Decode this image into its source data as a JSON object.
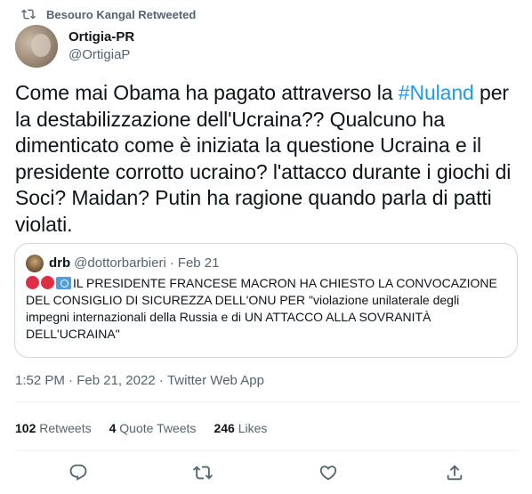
{
  "retweet_banner": {
    "icon": "retweet-icon",
    "text": "Besouro Kangal Retweeted"
  },
  "author": {
    "display_name": "Ortigia-PR",
    "handle": "@OrtigiaP"
  },
  "tweet": {
    "text_before": "Come mai Obama ha pagato attraverso la ",
    "hashtag": "#Nuland",
    "text_after": " per la destabilizzazione dell'Ucraina?? Qualcuno ha dimenticato come è iniziata la questione Ucraina e il presidente corrotto ucraino? l'attacco durante i giochi di Soci? Maidan? Putin ha ragione quando parla di patti violati."
  },
  "quote": {
    "name": "drb",
    "handle": "@dottorbarbieri",
    "separator": "·",
    "date": "Feb 21",
    "emoji_icons": [
      "red-circle-icon",
      "red-circle-icon",
      "un-flag-icon"
    ],
    "text": "IL PRESIDENTE FRANCESE MACRON HA CHIESTO LA CONVOCAZIONE DEL CONSIGLIO DI SICUREZZA DELL'ONU PER \"violazione unilaterale degli impegni internazionali della Russia e di UN ATTACCO ALLA SOVRANITÀ DELL'UCRAINA\""
  },
  "meta": {
    "time": "1:52 PM",
    "separator": " · ",
    "date": "Feb 21, 2022",
    "source": "Twitter Web App"
  },
  "stats": {
    "retweets": {
      "count": "102",
      "label": "Retweets"
    },
    "quote_tweets": {
      "count": "4",
      "label": "Quote Tweets"
    },
    "likes": {
      "count": "246",
      "label": "Likes"
    }
  },
  "actions": [
    "reply-icon",
    "retweet-icon",
    "like-icon",
    "share-icon"
  ],
  "colors": {
    "link": "#1d9bf0",
    "secondary_text": "#536471",
    "border": "#cfd9de",
    "text": "#0f1419"
  }
}
